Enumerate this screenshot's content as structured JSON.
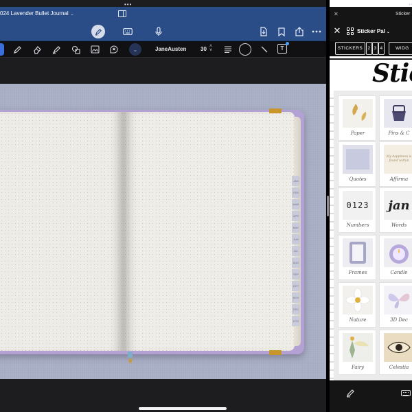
{
  "left_app": {
    "document_title": "024 Lavender Bullet Journal",
    "font_name": "JaneAusten",
    "font_size": "30",
    "nav_icons": [
      "pen-mode-icon",
      "keyboard-icon",
      "microphone-icon",
      "export-icon",
      "bookmark-icon",
      "share-icon",
      "more-icon"
    ],
    "tool_icons": [
      "pen-icon",
      "eraser-icon",
      "highlighter-icon",
      "shapes-icon",
      "image-icon",
      "sticker-icon",
      "text-align-icon",
      "line-tool-icon",
      "text-box-icon"
    ],
    "ink_color": "#111111",
    "accent_color": "#2b4d87",
    "canvas_color": "#a7adc3",
    "journal_cover_color": "#b4a1d4"
  },
  "right_app": {
    "window_title": "Sticker",
    "site_title": "Sticker Pal",
    "store_tabs": [
      "STICKERS",
      "2",
      "3",
      "4",
      "WIDG"
    ],
    "store_heading": "Stick",
    "categories": [
      {
        "label": "Paper",
        "thumb": "gold-leaf"
      },
      {
        "label": "Pins & C",
        "thumb": "binder-clip"
      },
      {
        "label": "Quotes",
        "thumb": "quote-card"
      },
      {
        "label": "Affirma",
        "thumb": "affirmation-card"
      },
      {
        "label": "Numbers",
        "thumb": "0123"
      },
      {
        "label": "Words",
        "thumb": "jan"
      },
      {
        "label": "Frames",
        "thumb": "picture-frame"
      },
      {
        "label": "Candle",
        "thumb": "candle"
      },
      {
        "label": "Nature",
        "thumb": "flower"
      },
      {
        "label": "3D Dec",
        "thumb": "butterfly"
      },
      {
        "label": "Fairy",
        "thumb": "fairy"
      },
      {
        "label": "Celestia",
        "thumb": "eye"
      }
    ],
    "quote_thumb_text": "My happiness is found within",
    "numbers_thumb_text": "0123",
    "words_thumb_text": "jan"
  }
}
